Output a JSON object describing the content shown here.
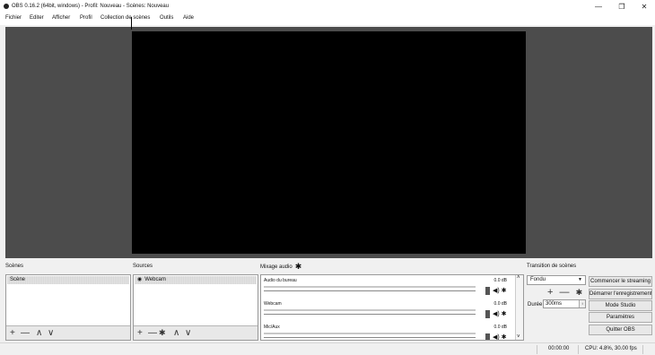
{
  "window": {
    "title": "OBS 0.16.2 (64bit, windows) - Profil: Nouveau - Scènes: Nouveau",
    "minimize_glyph": "—",
    "maximize_glyph": "❐",
    "close_glyph": "✕"
  },
  "menu": {
    "file": "Fichier",
    "edit": "Editer",
    "view": "Afficher",
    "profile": "Profil",
    "scene_collection": "Collection de scènes",
    "tools": "Outils",
    "help": "Aide"
  },
  "docks": {
    "scenes_label": "Scènes",
    "sources_label": "Sources",
    "mixer_label": "Mixage audio",
    "transitions_label": "Transition de scènes"
  },
  "scenes": {
    "items": [
      "Scène"
    ]
  },
  "sources": {
    "items": [
      "Webcam"
    ]
  },
  "mixer": {
    "channels": [
      {
        "name": "Audio du bureau",
        "db": "0.0 dB"
      },
      {
        "name": "Webcam",
        "db": "0.0 dB"
      },
      {
        "name": "Mic/Aux",
        "db": "0.0 dB"
      }
    ]
  },
  "transitions": {
    "selected": "Fondu",
    "duration_label": "Durée",
    "duration_value": "300ms"
  },
  "controls": {
    "start_streaming": "Commencer le streaming",
    "start_recording": "Démarrer l'enregistrement",
    "studio_mode": "Mode Studio",
    "settings": "Paramètres",
    "exit": "Quitter OBS"
  },
  "status": {
    "time": "00:00:00",
    "cpu": "CPU: 4.8%, 30.00 fps"
  },
  "icons": {
    "plus": "+",
    "minus": "—",
    "up": "∧",
    "down": "∨",
    "gear": "✱",
    "speaker": "◀)",
    "eye": "◉",
    "scroll_up": "˄",
    "scroll_down": "˅",
    "dropdown": "▼",
    "spin": "↕"
  }
}
